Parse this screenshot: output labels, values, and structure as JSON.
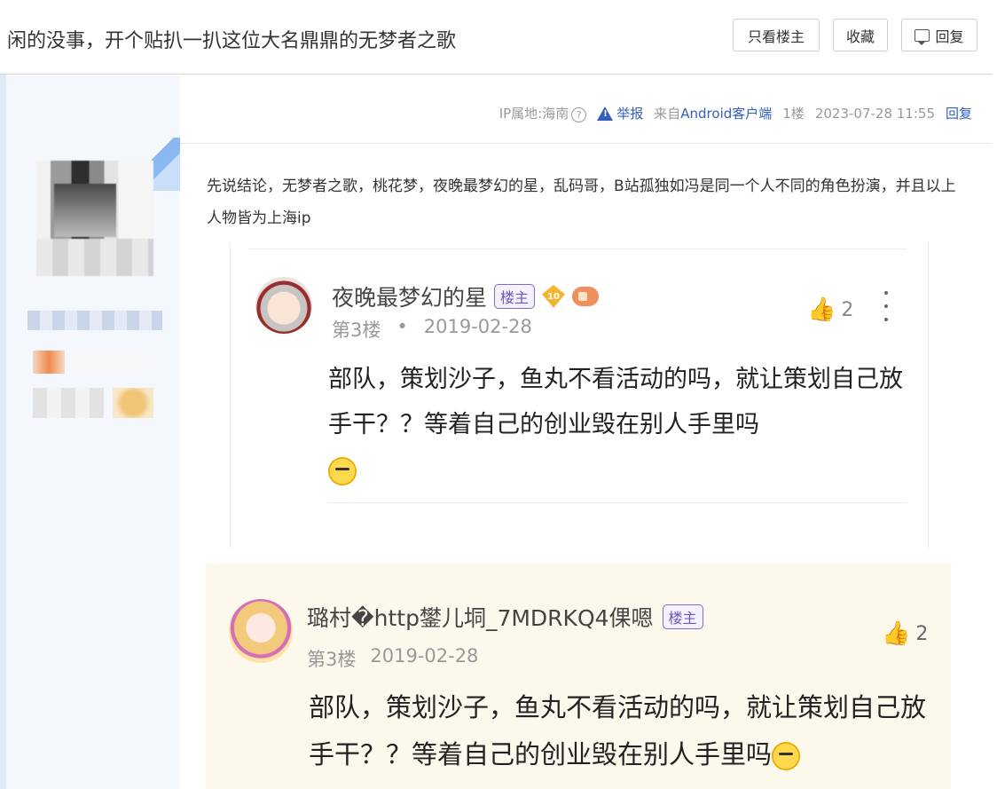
{
  "header": {
    "title": "闲的没事，开个贴扒一扒这位大名鼎鼎的无梦者之歌",
    "only_op_label": "只看楼主",
    "favorite_label": "收藏",
    "reply_label": "回复"
  },
  "post": {
    "ip_location": "IP属地:海南",
    "help_glyph": "?",
    "report_label": "举报",
    "client_prefix": "来自",
    "client_name": "Android客户端",
    "floor": "1楼",
    "timestamp": "2023-07-28 11:55",
    "reply_link": "回复",
    "body": "先说结论，无梦者之歌，桃花梦，夜晚最梦幻的星，乱码哥，B站孤独如冯是同一个人不同的角色扮演，并且以上人物皆为上海ip"
  },
  "screenshot_1": {
    "user_name": "夜晚最梦幻的星",
    "op_tag": "楼主",
    "level_badge": "10",
    "floor": "第3楼",
    "separator": "•",
    "date": "2019-02-28",
    "likes": "2",
    "text": "部队，策划沙子，鱼丸不看活动的吗，就让策划自己放手干？？等着自己的创业毁在别人手里吗"
  },
  "screenshot_2": {
    "user_name": "璐村�http鐢儿垌_7MDRKQ4倮嗯",
    "op_tag": "楼主",
    "floor": "第3楼",
    "date": "2019-02-28",
    "likes": "2",
    "text": "部队，策划沙子，鱼丸不看活动的吗，就让策划自己放手干？？等着自己的创业毁在别人手里吗"
  },
  "icons": {
    "thumb": "👍",
    "chat": "chat-icon",
    "warning": "warning-icon"
  },
  "colors": {
    "link_blue": "#3160c0",
    "sidebar_bg": "#f4f7fc",
    "op_tag_purple": "#6c58b9",
    "quote_bg": "#fdf8ec"
  }
}
